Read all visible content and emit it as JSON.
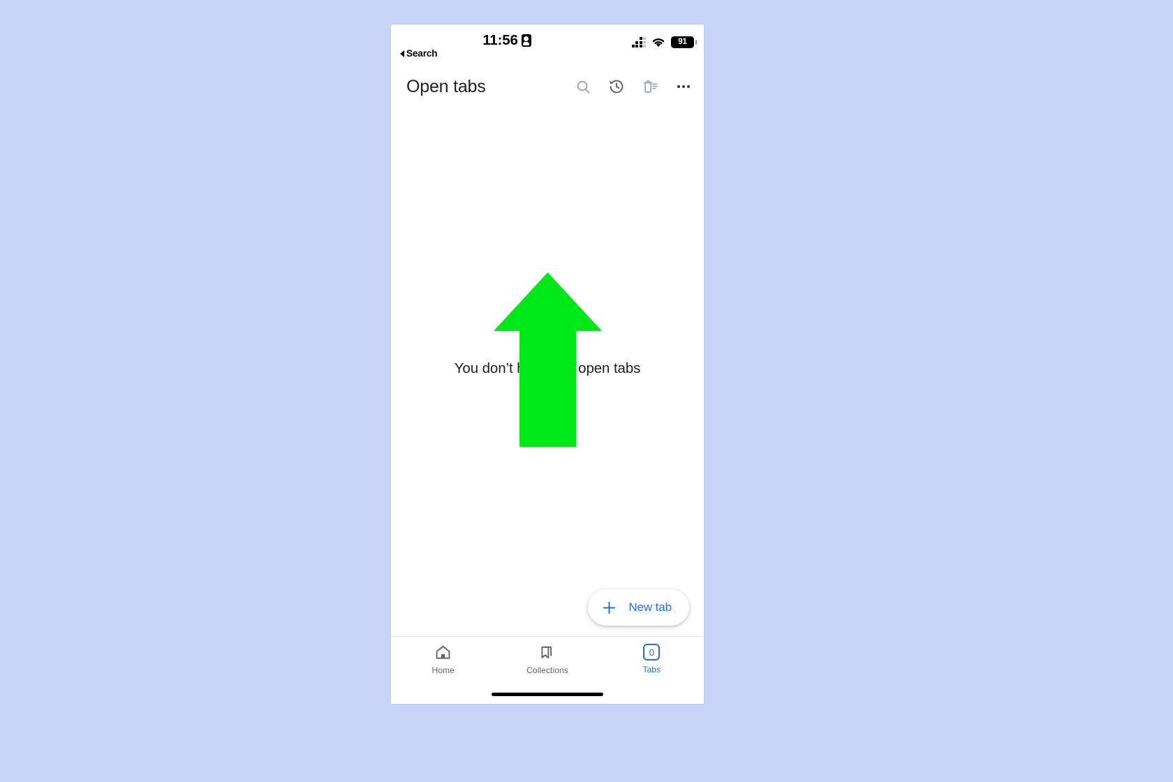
{
  "theme": {
    "page_background": "#c7d4f7",
    "screen_background": "#ffffff",
    "accent_blue": "#2b6cdb",
    "annotation_green": "#00e818",
    "text_primary": "#1f1f1f",
    "text_muted": "#5f6368"
  },
  "status_bar": {
    "time": "11:56",
    "recording_indicator_icon": "screen-recording-badge-icon",
    "cellular_icon": "cellular-signal-dots-icon",
    "wifi_icon": "wifi-icon",
    "battery_level": "91",
    "battery_icon": "battery-icon"
  },
  "back_link": {
    "label": "Search",
    "icon": "back-triangle-icon"
  },
  "header": {
    "title": "Open tabs",
    "actions": [
      {
        "name": "search-button",
        "icon": "search-icon",
        "label": "Search"
      },
      {
        "name": "history-button",
        "icon": "history-clock-icon",
        "label": "Recently closed"
      },
      {
        "name": "close-all-tabs-button",
        "icon": "trash-list-icon",
        "label": "Close all tabs"
      },
      {
        "name": "more-options-button",
        "icon": "more-horizontal-icon",
        "label": "More options"
      }
    ]
  },
  "empty_state": {
    "message": "You don’t have any open tabs"
  },
  "annotation": {
    "type": "arrow",
    "direction": "up",
    "color": "#00e818",
    "name": "annotation-arrow-up"
  },
  "new_tab_button": {
    "label": "New tab",
    "icon": "plus-icon"
  },
  "bottom_nav": {
    "items": [
      {
        "label": "Home",
        "icon": "home-icon",
        "active": false
      },
      {
        "label": "Collections",
        "icon": "bookmark-collections-icon",
        "active": false
      },
      {
        "label": "Tabs",
        "icon": "tabs-count-icon",
        "active": true,
        "count": "0"
      }
    ]
  }
}
